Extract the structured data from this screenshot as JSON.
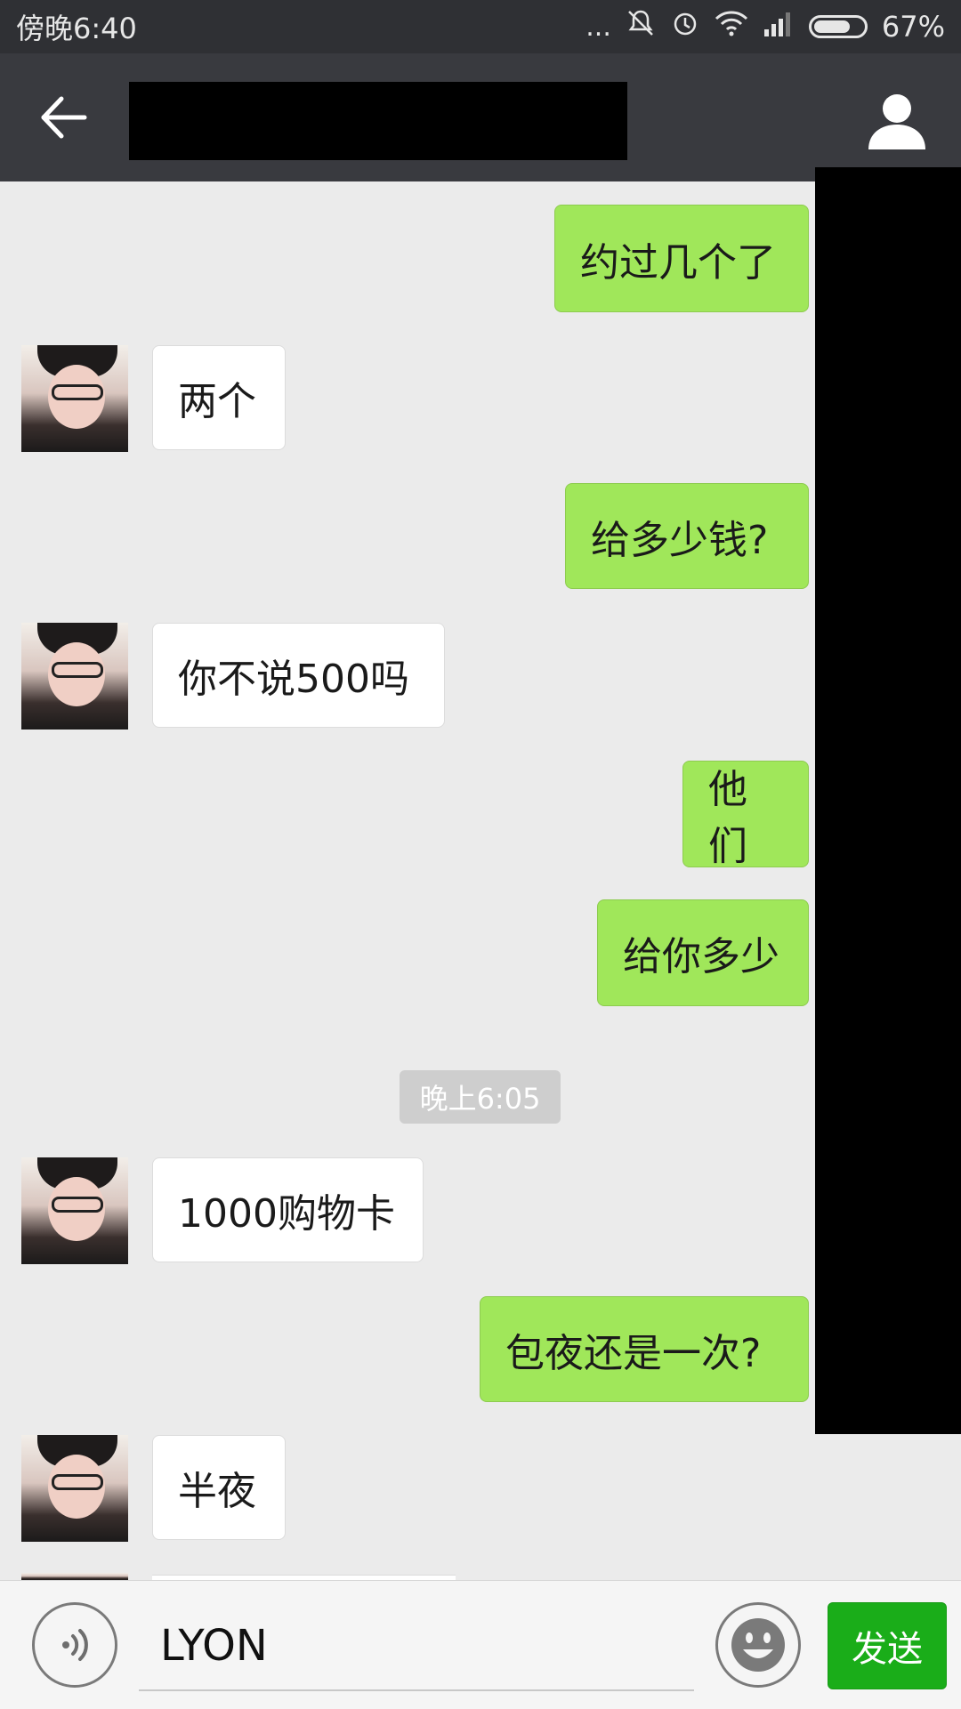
{
  "status_bar": {
    "time": "傍晚6:40",
    "dots": "...",
    "battery_percent": "67%",
    "icons": [
      "silent-icon",
      "alarm-icon",
      "wifi-icon",
      "signal-icon",
      "battery-icon"
    ]
  },
  "header": {
    "back_icon": "arrow-left-icon",
    "profile_icon": "person-icon"
  },
  "messages": [
    {
      "from": "me",
      "text": "约过几个了"
    },
    {
      "from": "them",
      "text": "两个"
    },
    {
      "from": "me",
      "text": "给多少钱?"
    },
    {
      "from": "them",
      "text": "你不说500吗"
    },
    {
      "from": "me",
      "text": "他们"
    },
    {
      "from": "me",
      "text": "给你多少"
    },
    {
      "from": "them",
      "text": "1000购物卡"
    },
    {
      "from": "me",
      "text": "包夜还是一次?"
    },
    {
      "from": "them",
      "text": "半夜"
    }
  ],
  "timestamp": "晚上6:05",
  "input_bar": {
    "value": "LYON",
    "send_label": "发送",
    "voice_icon": "voice-icon",
    "emoji_icon": "emoji-icon"
  },
  "colors": {
    "status_bg": "#2f3034",
    "header_bg": "#393a3f",
    "chat_bg": "#ebebeb",
    "my_bubble": "#a0e75a",
    "their_bubble": "#ffffff",
    "send_button": "#1aad19"
  }
}
